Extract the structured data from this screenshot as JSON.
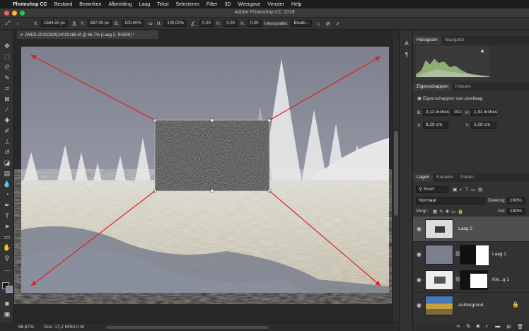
{
  "menubar": {
    "app": "Photoshop CC",
    "items": [
      "Bestand",
      "Bewerken",
      "Afbeelding",
      "Laag",
      "Tekst",
      "Selecteren",
      "Filter",
      "3D",
      "Weergave",
      "Venster",
      "Help"
    ]
  },
  "window": {
    "title": "Adobe Photoshop CC 2019"
  },
  "options": {
    "x_label": "X:",
    "x_value": "1564,50 px",
    "y_label": "Y:",
    "y_value": "887,00 px",
    "w_label": "B:",
    "w_value": "100,00%",
    "h_label": "H:",
    "h_value": "100,00%",
    "angle_value": "0,00",
    "hskew_label": "H:",
    "hskew_value": "0,00",
    "vskew_label": "V:",
    "vskew_value": "0,00",
    "interp_label": "Interpolatie:",
    "interp_value": "Bicubi..."
  },
  "document": {
    "tab_label": "JWED-20110924|24020168.tif @ 66,7% (Laag 2, RGB/8) *"
  },
  "status": {
    "zoom": "66,67%",
    "doc": "Doc: 17,2 M/50,0 M"
  },
  "panels": {
    "histogram_tabs": [
      "Histogram",
      "Navigator"
    ],
    "properties_tabs": [
      "Eigenschappen",
      "Historie"
    ],
    "properties_title": "Eigenschappen van pixellaag",
    "w_label": "B:",
    "w_value": "3,12 inches",
    "link_label": "GO",
    "h_label": "H:",
    "h_value": "1,91 inches",
    "x_label": "X:",
    "x_value": "9,29 cm",
    "y_label": "Y:",
    "y_value": "5,08 cm",
    "layers_tabs": [
      "Lagen",
      "Kanalen",
      "Paden"
    ],
    "filter_value": "Soort",
    "blend_value": "Normaal",
    "opacity_label": "Dekking:",
    "opacity_value": "100%",
    "lock_label": "Vergr.:",
    "fill_label": "Vul:",
    "fill_value": "100%",
    "layers": [
      {
        "name": "Laag 2"
      },
      {
        "name": "Laag 1"
      },
      {
        "name": "Kle...g 1"
      },
      {
        "name": "Achtergrond"
      }
    ]
  },
  "colors": {
    "accent_arrow": "#e02020",
    "sky": "#8a8e9a",
    "noise": "#3a3a3a"
  }
}
